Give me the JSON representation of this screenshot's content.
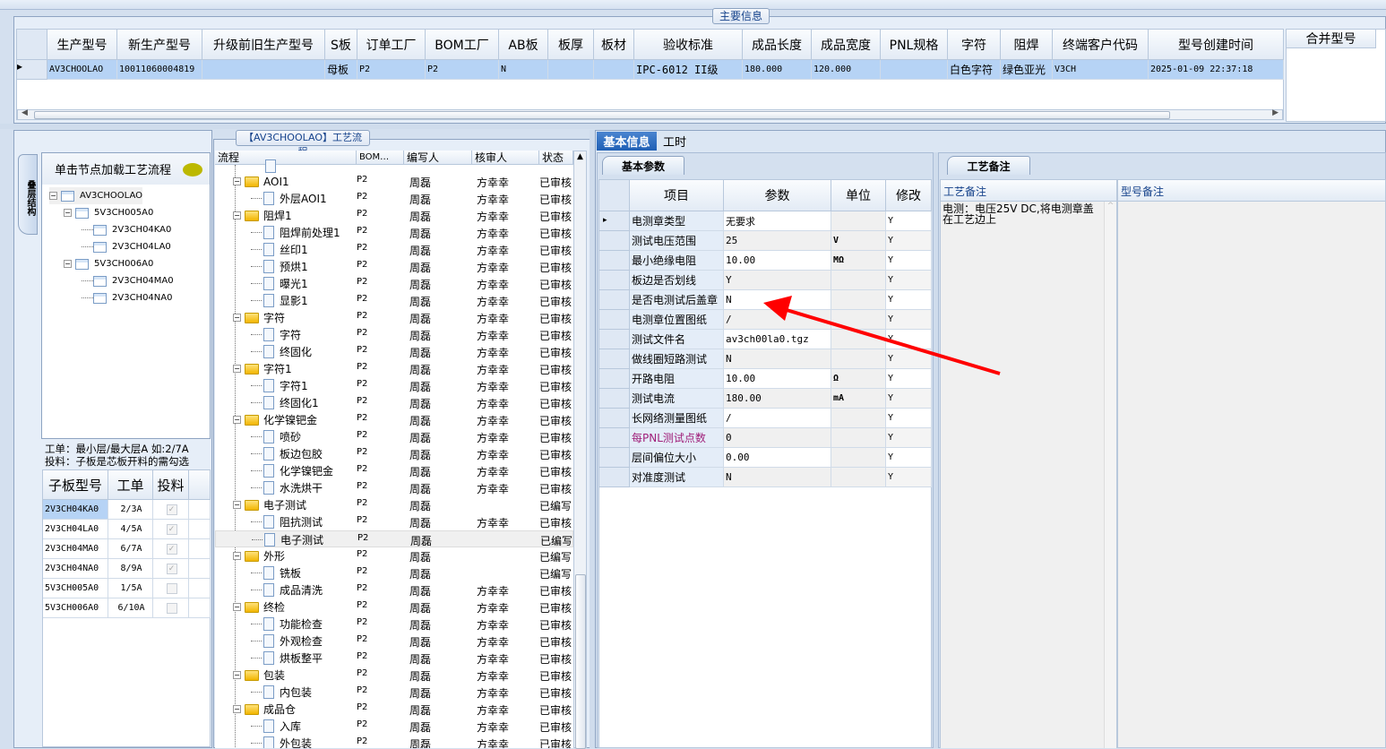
{
  "main_info": {
    "legend": "主要信息",
    "columns": [
      "生产型号",
      "新生产型号",
      "升级前旧生产型号",
      "S板",
      "订单工厂",
      "BOM工厂",
      "AB板",
      "板厚",
      "板材",
      "验收标准",
      "成品长度",
      "成品宽度",
      "PNL规格",
      "字符",
      "阻焊",
      "终端客户代码",
      "型号创建时间"
    ],
    "row": [
      "AV3CHOOLAO",
      "10011060004819",
      "",
      "母板",
      "P2",
      "P2",
      "N",
      "",
      "",
      "IPC-6012 II级",
      "180.000",
      "120.000",
      "",
      "白色字符",
      "绿色亚光",
      "V3CH",
      "2025-01-09 22:37:18"
    ],
    "merge_header": "合并型号"
  },
  "left": {
    "vertical_tab": "叠层结构",
    "tree_header": "单击节点加载工艺流程",
    "tree": [
      {
        "label": "AV3CHOOLAO",
        "level": 0
      },
      {
        "label": "5V3CH005A0",
        "level": 1
      },
      {
        "label": "2V3CH04KA0",
        "level": 2
      },
      {
        "label": "2V3CH04LA0",
        "level": 2
      },
      {
        "label": "5V3CH006A0",
        "level": 1
      },
      {
        "label": "2V3CH04MA0",
        "level": 2
      },
      {
        "label": "2V3CH04NA0",
        "level": 2
      }
    ],
    "note_line1": "工单：最小层/最大层A 如:2/7A",
    "note_line2": "投料：子板是芯板开料的需勾选",
    "sub_columns": [
      "子板型号",
      "工单",
      "投料"
    ],
    "sub_rows": [
      {
        "model": "2V3CH04KA0",
        "order": "2/3A",
        "feed": true
      },
      {
        "model": "2V3CH04LA0",
        "order": "4/5A",
        "feed": true
      },
      {
        "model": "2V3CH04MA0",
        "order": "6/7A",
        "feed": true
      },
      {
        "model": "2V3CH04NA0",
        "order": "8/9A",
        "feed": true
      },
      {
        "model": "5V3CH005A0",
        "order": "1/5A",
        "feed": false
      },
      {
        "model": "5V3CH006A0",
        "order": "6/10A",
        "feed": false
      }
    ]
  },
  "process": {
    "legend": "【AV3CHOOLAO】工艺流程",
    "columns": [
      "流程",
      "BOM…",
      "编写人",
      "核审人",
      "状态"
    ],
    "rows": [
      {
        "name": "AOI1",
        "folder": true,
        "bom": "P2",
        "writer": "周磊",
        "reviewer": "方幸幸",
        "status": "已审核"
      },
      {
        "name": "外层AOI1",
        "folder": false,
        "bom": "P2",
        "writer": "周磊",
        "reviewer": "方幸幸",
        "status": "已审核"
      },
      {
        "name": "阻焊1",
        "folder": true,
        "bom": "P2",
        "writer": "周磊",
        "reviewer": "方幸幸",
        "status": "已审核"
      },
      {
        "name": "阻焊前处理1",
        "folder": false,
        "bom": "P2",
        "writer": "周磊",
        "reviewer": "方幸幸",
        "status": "已审核"
      },
      {
        "name": "丝印1",
        "folder": false,
        "bom": "P2",
        "writer": "周磊",
        "reviewer": "方幸幸",
        "status": "已审核"
      },
      {
        "name": "预烘1",
        "folder": false,
        "bom": "P2",
        "writer": "周磊",
        "reviewer": "方幸幸",
        "status": "已审核"
      },
      {
        "name": "曝光1",
        "folder": false,
        "bom": "P2",
        "writer": "周磊",
        "reviewer": "方幸幸",
        "status": "已审核"
      },
      {
        "name": "显影1",
        "folder": false,
        "bom": "P2",
        "writer": "周磊",
        "reviewer": "方幸幸",
        "status": "已审核"
      },
      {
        "name": "字符",
        "folder": true,
        "bom": "P2",
        "writer": "周磊",
        "reviewer": "方幸幸",
        "status": "已审核"
      },
      {
        "name": "字符",
        "folder": false,
        "bom": "P2",
        "writer": "周磊",
        "reviewer": "方幸幸",
        "status": "已审核"
      },
      {
        "name": "终固化",
        "folder": false,
        "bom": "P2",
        "writer": "周磊",
        "reviewer": "方幸幸",
        "status": "已审核"
      },
      {
        "name": "字符1",
        "folder": true,
        "bom": "P2",
        "writer": "周磊",
        "reviewer": "方幸幸",
        "status": "已审核"
      },
      {
        "name": "字符1",
        "folder": false,
        "bom": "P2",
        "writer": "周磊",
        "reviewer": "方幸幸",
        "status": "已审核"
      },
      {
        "name": "终固化1",
        "folder": false,
        "bom": "P2",
        "writer": "周磊",
        "reviewer": "方幸幸",
        "status": "已审核"
      },
      {
        "name": "化学镍钯金",
        "folder": true,
        "bom": "P2",
        "writer": "周磊",
        "reviewer": "方幸幸",
        "status": "已审核"
      },
      {
        "name": "喷砂",
        "folder": false,
        "bom": "P2",
        "writer": "周磊",
        "reviewer": "方幸幸",
        "status": "已审核"
      },
      {
        "name": "板边包胶",
        "folder": false,
        "bom": "P2",
        "writer": "周磊",
        "reviewer": "方幸幸",
        "status": "已审核"
      },
      {
        "name": "化学镍钯金",
        "folder": false,
        "bom": "P2",
        "writer": "周磊",
        "reviewer": "方幸幸",
        "status": "已审核"
      },
      {
        "name": "水洗烘干",
        "folder": false,
        "bom": "P2",
        "writer": "周磊",
        "reviewer": "方幸幸",
        "status": "已审核"
      },
      {
        "name": "电子测试",
        "folder": true,
        "bom": "P2",
        "writer": "周磊",
        "reviewer": "",
        "status": "已编写"
      },
      {
        "name": "阻抗测试",
        "folder": false,
        "bom": "P2",
        "writer": "周磊",
        "reviewer": "方幸幸",
        "status": "已审核"
      },
      {
        "name": "电子测试",
        "folder": false,
        "bom": "P2",
        "writer": "周磊",
        "reviewer": "",
        "status": "已编写",
        "selected": true
      },
      {
        "name": "外形",
        "folder": true,
        "bom": "P2",
        "writer": "周磊",
        "reviewer": "",
        "status": "已编写"
      },
      {
        "name": "铣板",
        "folder": false,
        "bom": "P2",
        "writer": "周磊",
        "reviewer": "",
        "status": "已编写"
      },
      {
        "name": "成品清洗",
        "folder": false,
        "bom": "P2",
        "writer": "周磊",
        "reviewer": "方幸幸",
        "status": "已审核"
      },
      {
        "name": "终检",
        "folder": true,
        "bom": "P2",
        "writer": "周磊",
        "reviewer": "方幸幸",
        "status": "已审核"
      },
      {
        "name": "功能检查",
        "folder": false,
        "bom": "P2",
        "writer": "周磊",
        "reviewer": "方幸幸",
        "status": "已审核"
      },
      {
        "name": "外观检查",
        "folder": false,
        "bom": "P2",
        "writer": "周磊",
        "reviewer": "方幸幸",
        "status": "已审核"
      },
      {
        "name": "烘板整平",
        "folder": false,
        "bom": "P2",
        "writer": "周磊",
        "reviewer": "方幸幸",
        "status": "已审核"
      },
      {
        "name": "包装",
        "folder": true,
        "bom": "P2",
        "writer": "周磊",
        "reviewer": "方幸幸",
        "status": "已审核"
      },
      {
        "name": "内包装",
        "folder": false,
        "bom": "P2",
        "writer": "周磊",
        "reviewer": "方幸幸",
        "status": "已审核"
      },
      {
        "name": "成品仓",
        "folder": true,
        "bom": "P2",
        "writer": "周磊",
        "reviewer": "方幸幸",
        "status": "已审核"
      },
      {
        "name": "入库",
        "folder": false,
        "bom": "P2",
        "writer": "周磊",
        "reviewer": "方幸幸",
        "status": "已审核"
      },
      {
        "name": "外包装",
        "folder": false,
        "bom": "P2",
        "writer": "周磊",
        "reviewer": "方幸幸",
        "status": "已审核"
      }
    ]
  },
  "right": {
    "tabs": [
      "基本信息",
      "工时"
    ],
    "params_tab": "基本参数",
    "param_columns": [
      "项目",
      "参数",
      "单位",
      "修改"
    ],
    "params": [
      {
        "item": "电测章类型",
        "value": "无要求",
        "unit": "",
        "edit": "Y"
      },
      {
        "item": "测试电压范围",
        "value": "25",
        "unit": "V",
        "edit": "Y"
      },
      {
        "item": "最小绝缘电阻",
        "value": "10.00",
        "unit": "MΩ",
        "edit": "Y"
      },
      {
        "item": "板边是否划线",
        "value": "Y",
        "unit": "",
        "edit": "Y"
      },
      {
        "item": "是否电测试后盖章",
        "value": "N",
        "unit": "",
        "edit": "Y"
      },
      {
        "item": "电测章位置图纸",
        "value": "/",
        "unit": "",
        "edit": "Y"
      },
      {
        "item": "测试文件名",
        "value": "av3ch00la0.tgz",
        "unit": "",
        "edit": "Y"
      },
      {
        "item": "做线圈短路测试",
        "value": "N",
        "unit": "",
        "edit": "Y"
      },
      {
        "item": "开路电阻",
        "value": "10.00",
        "unit": "Ω",
        "edit": "Y"
      },
      {
        "item": "测试电流",
        "value": "180.00",
        "unit": "mA",
        "edit": "Y"
      },
      {
        "item": "长网络测量图纸",
        "value": "/",
        "unit": "",
        "edit": "Y"
      },
      {
        "item": "每PNL测试点数",
        "value": "0",
        "unit": "",
        "edit": "Y",
        "highlight": true
      },
      {
        "item": "层间偏位大小",
        "value": "0.00",
        "unit": "",
        "edit": "Y"
      },
      {
        "item": "对准度测试",
        "value": "N",
        "unit": "",
        "edit": "Y"
      }
    ],
    "notes_tab": "工艺备注",
    "notes_columns": [
      "工艺备注",
      "型号备注"
    ],
    "process_note": "电测：电压25V DC,将电测章盖在工艺边上",
    "highlight_color": "#a0207a",
    "annotation_arrow_color": "#ff0000"
  }
}
